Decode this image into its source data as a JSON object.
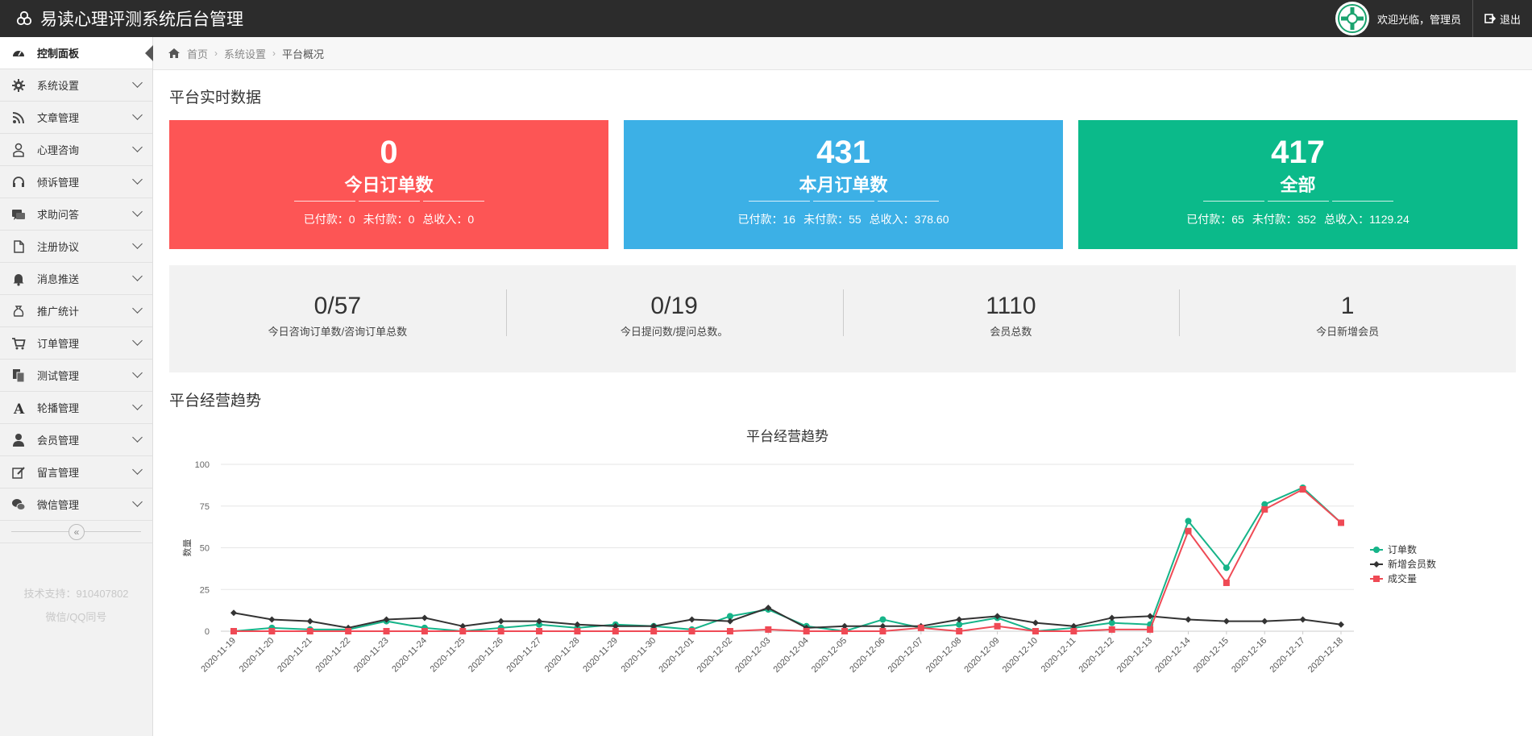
{
  "app": {
    "title": "易读心理评测系统后台管理",
    "welcome": "欢迎光临，管理员",
    "logout_label": "退出"
  },
  "sidebar": {
    "items": [
      {
        "label": "控制面板",
        "icon": "dashboard-icon",
        "active": true
      },
      {
        "label": "系统设置",
        "icon": "gear-icon"
      },
      {
        "label": "文章管理",
        "icon": "rss-icon"
      },
      {
        "label": "心理咨询",
        "icon": "user-md-icon"
      },
      {
        "label": "倾诉管理",
        "icon": "headset-icon"
      },
      {
        "label": "求助问答",
        "icon": "chat-icon"
      },
      {
        "label": "注册协议",
        "icon": "file-icon"
      },
      {
        "label": "消息推送",
        "icon": "bell-icon"
      },
      {
        "label": "推广统计",
        "icon": "money-bag-icon"
      },
      {
        "label": "订单管理",
        "icon": "cart-icon"
      },
      {
        "label": "测试管理",
        "icon": "copy-icon"
      },
      {
        "label": "轮播管理",
        "icon": "font-icon"
      },
      {
        "label": "会员管理",
        "icon": "user-icon"
      },
      {
        "label": "留言管理",
        "icon": "edit-icon"
      },
      {
        "label": "微信管理",
        "icon": "wechat-icon"
      }
    ],
    "collapse_glyph": "«",
    "support_line1": "技术支持：910407802",
    "support_line2": "微信/QQ同号"
  },
  "breadcrumb": {
    "home": "首页",
    "level1": "系统设置",
    "current": "平台概况"
  },
  "realtime": {
    "title": "平台实时数据",
    "cards": [
      {
        "value": "0",
        "label": "今日订单数",
        "paid_label": "已付款：",
        "paid": "0",
        "unpaid_label": "未付款：",
        "unpaid": "0",
        "income_label": "总收入：",
        "income": "0",
        "color": "#fd5555"
      },
      {
        "value": "431",
        "label": "本月订单数",
        "paid_label": "已付款：",
        "paid": "16",
        "unpaid_label": "未付款：",
        "unpaid": "55",
        "income_label": "总收入：",
        "income": "378.60",
        "color": "#3cb0e6"
      },
      {
        "value": "417",
        "label": "全部",
        "paid_label": "已付款：",
        "paid": "65",
        "unpaid_label": "未付款：",
        "unpaid": "352",
        "income_label": "总收入：",
        "income": "1129.24",
        "color": "#0bba8a"
      }
    ],
    "stats": [
      {
        "value": "0/57",
        "label": "今日咨询订单数/咨询订单总数"
      },
      {
        "value": "0/19",
        "label": "今日提问数/提问总数。"
      },
      {
        "value": "1110",
        "label": "会员总数"
      },
      {
        "value": "1",
        "label": "今日新增会员"
      }
    ]
  },
  "trend": {
    "section_title": "平台经营趋势"
  },
  "chart_data": {
    "type": "line",
    "title": "平台经营趋势",
    "ylabel": "数量",
    "ylim": [
      0,
      100
    ],
    "yticks": [
      0,
      25,
      50,
      75,
      100
    ],
    "legend_position": "right",
    "categories": [
      "2020-11-19",
      "2020-11-20",
      "2020-11-21",
      "2020-11-22",
      "2020-11-23",
      "2020-11-24",
      "2020-11-25",
      "2020-11-26",
      "2020-11-27",
      "2020-11-28",
      "2020-11-29",
      "2020-11-30",
      "2020-12-01",
      "2020-12-02",
      "2020-12-03",
      "2020-12-04",
      "2020-12-05",
      "2020-12-06",
      "2020-12-07",
      "2020-12-08",
      "2020-12-09",
      "2020-12-10",
      "2020-12-11",
      "2020-12-12",
      "2020-12-13",
      "2020-12-14",
      "2020-12-15",
      "2020-12-16",
      "2020-12-17",
      "2020-12-18"
    ],
    "series": [
      {
        "name": "订单数",
        "color": "#16b489",
        "marker": "circle",
        "values": [
          0,
          2,
          1,
          1,
          6,
          2,
          0,
          2,
          4,
          2,
          4,
          3,
          1,
          9,
          13,
          3,
          0,
          7,
          2,
          4,
          8,
          0,
          2,
          5,
          4,
          66,
          38,
          76,
          86,
          65
        ]
      },
      {
        "name": "新增会员数",
        "color": "#333333",
        "marker": "diamond",
        "values": [
          11,
          7,
          6,
          2,
          7,
          8,
          3,
          6,
          6,
          4,
          3,
          3,
          7,
          6,
          14,
          2,
          3,
          3,
          3,
          7,
          9,
          5,
          3,
          8,
          9,
          7,
          6,
          6,
          7,
          4
        ]
      },
      {
        "name": "成交量",
        "color": "#ef4a55",
        "marker": "square",
        "values": [
          0,
          0,
          0,
          0,
          0,
          0,
          0,
          0,
          0,
          0,
          0,
          0,
          0,
          0,
          1,
          0,
          0,
          0,
          2,
          0,
          3,
          0,
          0,
          1,
          1,
          60,
          29,
          73,
          85,
          65
        ]
      }
    ]
  }
}
